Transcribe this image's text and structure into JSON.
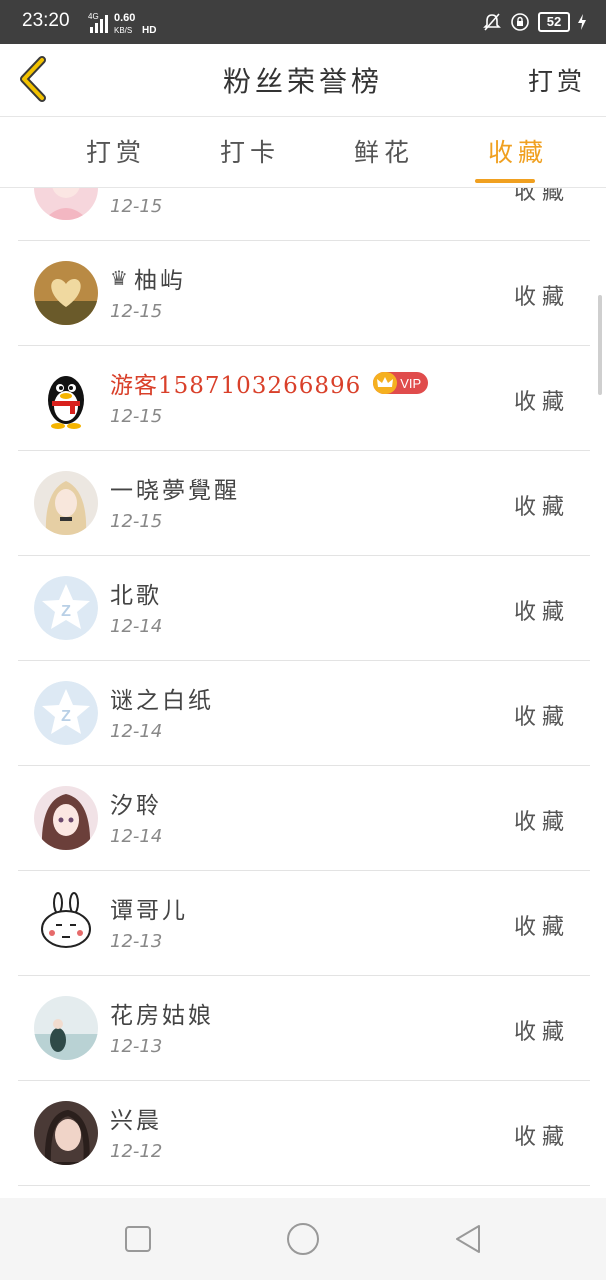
{
  "status": {
    "time": "23:20",
    "net_type": "4G",
    "net_speed": "0.60",
    "net_unit": "KB/S",
    "hd": "HD",
    "battery": "52"
  },
  "header": {
    "title": "粉丝荣誉榜",
    "action": "打赏"
  },
  "tabs": [
    {
      "label": "打赏"
    },
    {
      "label": "打卡"
    },
    {
      "label": "鲜花"
    },
    {
      "label": "收藏",
      "active": true
    }
  ],
  "rows": [
    {
      "name": "",
      "date": "12-15",
      "action": "收藏",
      "avatar": "girl-pink"
    },
    {
      "name": "柚屿",
      "date": "12-15",
      "action": "收藏",
      "avatar": "heart-photo",
      "crown": true
    },
    {
      "name": "游客1587103266896",
      "date": "12-15",
      "action": "收藏",
      "avatar": "qq-penguin",
      "vip": "VIP"
    },
    {
      "name": "一晓夢覺醒",
      "date": "12-15",
      "action": "收藏",
      "avatar": "blonde-girl"
    },
    {
      "name": "北歌",
      "date": "12-14",
      "action": "收藏",
      "avatar": "default-star"
    },
    {
      "name": "谜之白纸",
      "date": "12-14",
      "action": "收藏",
      "avatar": "default-star"
    },
    {
      "name": "汐聆",
      "date": "12-14",
      "action": "收藏",
      "avatar": "anime-girl"
    },
    {
      "name": "谭哥儿",
      "date": "12-13",
      "action": "收藏",
      "avatar": "rabbit"
    },
    {
      "name": "花房姑娘",
      "date": "12-13",
      "action": "收藏",
      "avatar": "sea-photo"
    },
    {
      "name": "兴晨",
      "date": "12-12",
      "action": "收藏",
      "avatar": "girl-dark"
    }
  ],
  "colors": {
    "accent": "#f0a020",
    "vip_name": "#d9402a",
    "statusbar": "#3f3f3f"
  }
}
